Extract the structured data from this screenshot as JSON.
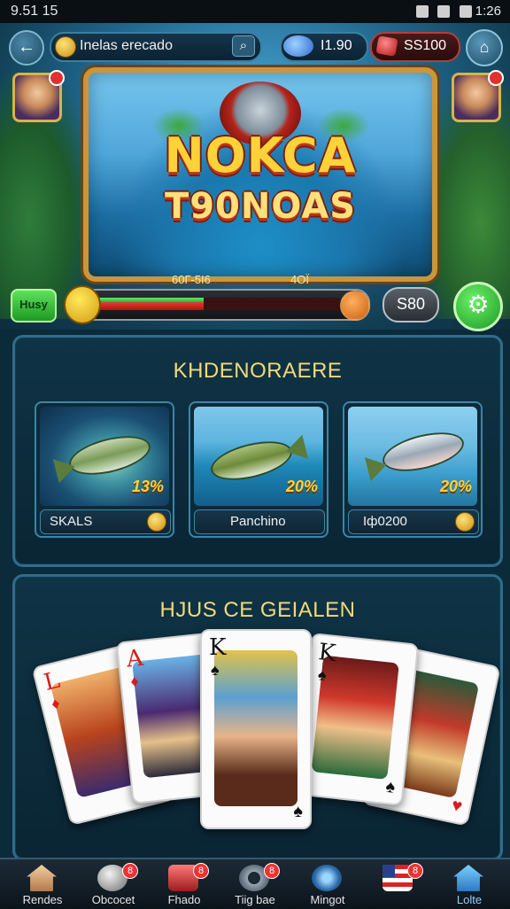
{
  "status_bar": {
    "time_left": "9.51 15",
    "time_right": "1:26"
  },
  "top_bar": {
    "search_text": "Inelas erecado",
    "gem_value": "I1.90",
    "cash_value": "SS100"
  },
  "banner": {
    "title_line1": "NOKCA",
    "title_line2": "T90NOAS"
  },
  "progress": {
    "label_left": "60Г-5І6",
    "label_right": "4ОЇ",
    "button_label": "Husy",
    "score": "S80",
    "fill_fraction": 0.45
  },
  "section1": {
    "title": "KHDENORAERE",
    "cards": [
      {
        "label": "SKALS",
        "percent": "13%"
      },
      {
        "label": "Panchino",
        "percent": "20%"
      },
      {
        "label": "Iф0200",
        "percent": "20%"
      }
    ]
  },
  "section2": {
    "title": "HJUS CE GEIALEN",
    "cards": [
      {
        "rank": "L",
        "suit": "♦",
        "color": "red"
      },
      {
        "rank": "A",
        "suit": "♦",
        "color": "red"
      },
      {
        "rank": "K",
        "suit": "♠",
        "color": "black"
      },
      {
        "rank": "K",
        "suit": "♠",
        "color": "black"
      },
      {
        "rank": "",
        "suit": "♥",
        "color": "red"
      }
    ]
  },
  "bottom_nav": {
    "items": [
      {
        "label": "Rendes",
        "icon": "home-icon"
      },
      {
        "label": "Obcocet",
        "icon": "coin-icon",
        "badge": "8"
      },
      {
        "label": "Fhado",
        "icon": "shop-icon",
        "badge": "8"
      },
      {
        "label": "Tiig bae",
        "icon": "gear-icon",
        "badge": "8"
      },
      {
        "label": "Mingot",
        "icon": "globe-icon"
      },
      {
        "label": "",
        "icon": "flag-icon",
        "badge": "8"
      },
      {
        "label": "Lolte",
        "icon": "lobby-icon"
      }
    ]
  },
  "colors": {
    "accent_gold": "#f3d97a",
    "panel_border": "#2f6d8a",
    "green_button": "#1e9a23"
  }
}
